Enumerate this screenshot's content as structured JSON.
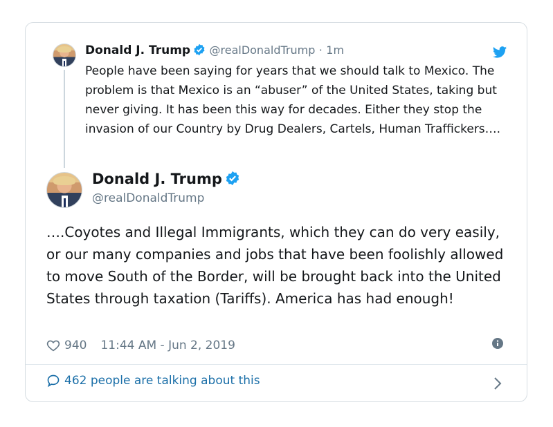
{
  "quoted_tweet": {
    "name": "Donald J. Trump",
    "handle": "@realDonaldTrump",
    "separator": "·",
    "time": "1m",
    "text": "People have been saying for years that we should talk to Mexico. The problem is that Mexico is an “abuser” of the United States, taking but never giving. It has been this way for decades. Either they stop the invasion of our Country by Drug Dealers, Cartels, Human Traffickers…."
  },
  "main_tweet": {
    "name": "Donald J. Trump",
    "handle": "@realDonaldTrump",
    "text": "….Coyotes and Illegal Immigrants, which they can do very easily, or our many companies and jobs that have been foolishly allowed to move South of the Border, will be brought back into the United States through taxation (Tariffs). America has had enough!",
    "likes": "940",
    "timestamp": "11:44 AM - Jun 2, 2019"
  },
  "footer": {
    "talking_label": "462 people are talking about this"
  },
  "colors": {
    "verified": "#1da1f2",
    "link": "#1b6fa8",
    "muted": "#657786",
    "border": "#d6dde2"
  },
  "icons": [
    "verified-badge-icon",
    "twitter-bird-icon",
    "heart-icon",
    "info-icon",
    "speech-bubble-icon",
    "chevron-right-icon"
  ]
}
